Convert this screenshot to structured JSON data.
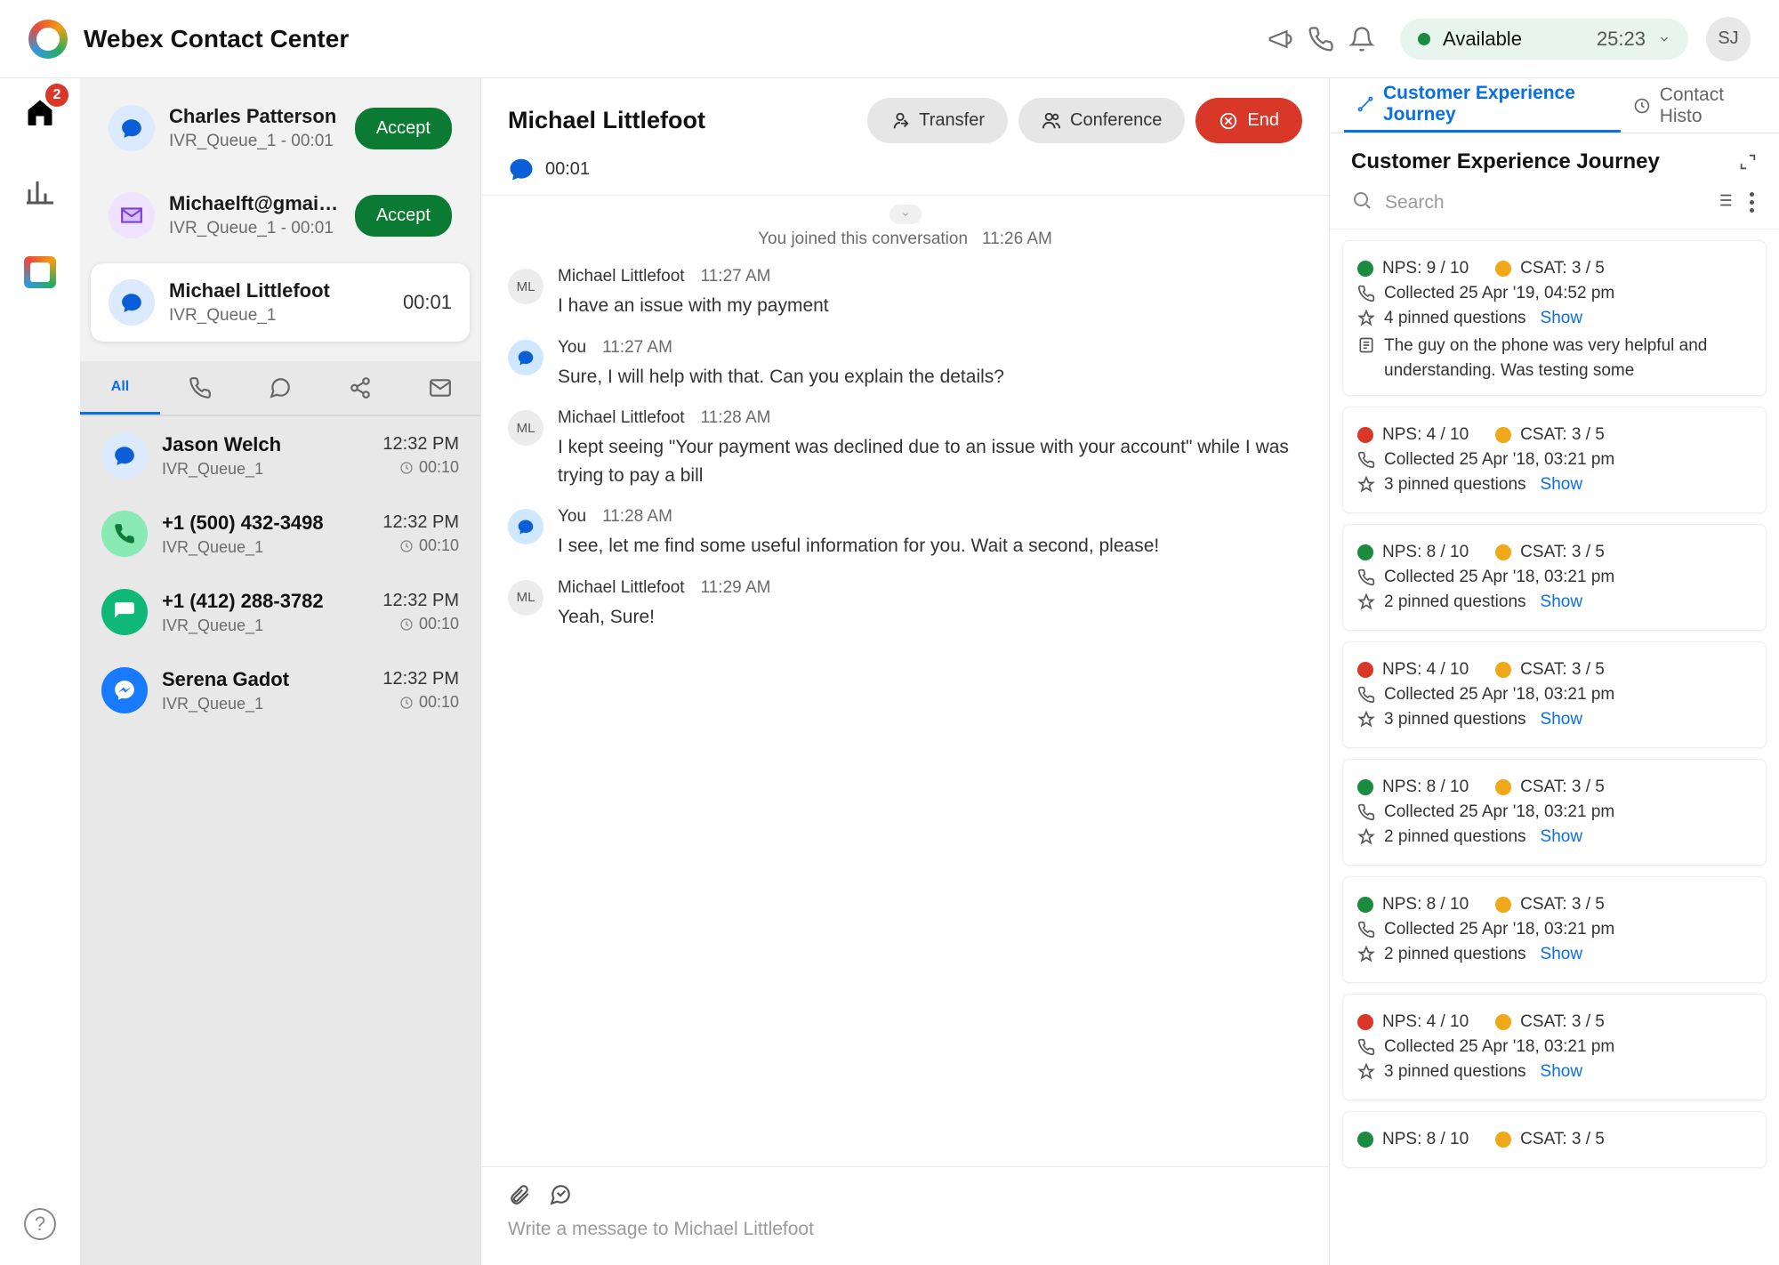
{
  "header": {
    "title": "Webex Contact Center",
    "status_label": "Available",
    "status_timer": "25:23",
    "user_initials": "SJ"
  },
  "rail": {
    "badge_count": "2"
  },
  "incoming": [
    {
      "name": "Charles Patterson",
      "sub": "IVR_Queue_1 - 00:01",
      "btn": "Accept",
      "icon": "chat"
    },
    {
      "name": "Michaelft@gmail.c..",
      "sub": "IVR_Queue_1 - 00:01",
      "btn": "Accept",
      "icon": "email"
    }
  ],
  "active_task": {
    "name": "Michael Littlefoot",
    "sub": "IVR_Queue_1",
    "timer": "00:01"
  },
  "history_tabs": {
    "all": "All"
  },
  "history": [
    {
      "name": "Jason Welch",
      "sub": "IVR_Queue_1",
      "time": "12:32 PM",
      "dur": "00:10",
      "icon": "chat"
    },
    {
      "name": "+1 (500) 432-3498",
      "sub": "IVR_Queue_1",
      "time": "12:32 PM",
      "dur": "00:10",
      "icon": "phone"
    },
    {
      "name": "+1 (412) 288-3782",
      "sub": "IVR_Queue_1",
      "time": "12:32 PM",
      "dur": "00:10",
      "icon": "sms"
    },
    {
      "name": "Serena Gadot",
      "sub": "IVR_Queue_1",
      "time": "12:32 PM",
      "dur": "00:10",
      "icon": "msgr"
    }
  ],
  "convo": {
    "title": "Michael Littlefoot",
    "timer": "00:01",
    "transfer": "Transfer",
    "conference": "Conference",
    "end": "End",
    "joined_text": "You joined this conversation",
    "joined_time": "11:26 AM",
    "compose_placeholder": "Write a message to Michael Littlefoot"
  },
  "messages": [
    {
      "who": "Michael Littlefoot",
      "time": "11:27 AM",
      "text": "I have an issue with my payment",
      "side": "cust",
      "initials": "ML"
    },
    {
      "who": "You",
      "time": "11:27 AM",
      "text": "Sure, I will help with that. Can you explain the details?",
      "side": "agent"
    },
    {
      "who": "Michael Littlefoot",
      "time": "11:28 AM",
      "text": "I kept seeing \"Your payment was declined due to an issue with your account\" while I was trying to pay a bill",
      "side": "cust",
      "initials": "ML"
    },
    {
      "who": "You",
      "time": "11:28 AM",
      "text": "I see, let me find some useful information for you. Wait a second, please!",
      "side": "agent"
    },
    {
      "who": "Michael Littlefoot",
      "time": "11:29 AM",
      "text": "Yeah, Sure!",
      "side": "cust",
      "initials": "ML"
    }
  ],
  "journey": {
    "tab_active": "Customer Experience Journey",
    "tab_inactive": "Contact Histo",
    "title": "Customer Experience Journey",
    "search_placeholder": "Search",
    "show_label": "Show"
  },
  "journey_cards": [
    {
      "nps": "NPS: 9 / 10",
      "nps_color": "g",
      "csat": "CSAT: 3 / 5",
      "collected": "Collected 25 Apr '19, 04:52 pm",
      "pinned": "4 pinned questions",
      "comment": "The guy on the phone was very helpful and understanding. Was testing some"
    },
    {
      "nps": "NPS: 4 / 10",
      "nps_color": "r",
      "csat": "CSAT: 3 / 5",
      "collected": "Collected 25 Apr '18, 03:21 pm",
      "pinned": "3 pinned questions"
    },
    {
      "nps": "NPS: 8 / 10",
      "nps_color": "g",
      "csat": "CSAT: 3 / 5",
      "collected": "Collected 25 Apr '18, 03:21 pm",
      "pinned": "2 pinned questions"
    },
    {
      "nps": "NPS: 4 / 10",
      "nps_color": "r",
      "csat": "CSAT: 3 / 5",
      "collected": "Collected 25 Apr '18, 03:21 pm",
      "pinned": "3 pinned questions"
    },
    {
      "nps": "NPS: 8 / 10",
      "nps_color": "g",
      "csat": "CSAT: 3 / 5",
      "collected": "Collected 25 Apr '18, 03:21 pm",
      "pinned": "2 pinned questions"
    },
    {
      "nps": "NPS: 8 / 10",
      "nps_color": "g",
      "csat": "CSAT: 3 / 5",
      "collected": "Collected 25 Apr '18, 03:21 pm",
      "pinned": "2 pinned questions"
    },
    {
      "nps": "NPS: 4 / 10",
      "nps_color": "r",
      "csat": "CSAT: 3 / 5",
      "collected": "Collected 25 Apr '18, 03:21 pm",
      "pinned": "3 pinned questions"
    },
    {
      "nps": "NPS: 8 / 10",
      "nps_color": "g",
      "csat": "CSAT: 3 / 5",
      "collected": "",
      "pinned": ""
    }
  ]
}
